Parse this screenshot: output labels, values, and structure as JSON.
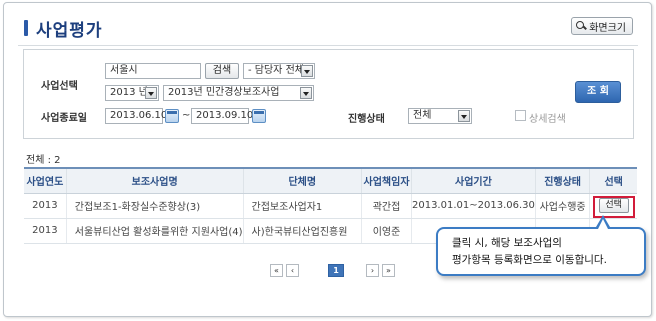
{
  "header": {
    "title": "사업평가",
    "zoom_button": "화면크기"
  },
  "search": {
    "business_select_label": "사업선택",
    "keyword_value": "서울시",
    "search_button": "검색",
    "manager_select": "- 담당자 전체 -",
    "year_select": "2013 년",
    "project_select": "2013년 민간경상보조사업",
    "end_date_label": "사업종료일",
    "date_from": "2013.06.10",
    "tilde": "~",
    "date_to": "2013.09.10",
    "status_label": "진행상태",
    "status_select": "전체",
    "detail_checkbox_label": "상세검색",
    "submit_button": "조 회"
  },
  "results": {
    "total_text": "전체 : 2",
    "columns": [
      "사업연도",
      "보조사업명",
      "단체명",
      "사업책임자",
      "사업기간",
      "진행상태",
      "선택"
    ],
    "rows": [
      {
        "year": "2013",
        "name": "간접보조1-화장실수준향상(3)",
        "org": "간접보조사업자1",
        "manager": "곽간접",
        "period": "2013.01.01~2013.06.30",
        "status": "사업수행중",
        "select": "선택"
      },
      {
        "year": "2013",
        "name": "서울뷰티산업 활성화를위한 지원사업(4)",
        "org": "사)한국뷰티산업진흥원",
        "manager": "이영준",
        "period": "",
        "status": "",
        "select": ""
      }
    ]
  },
  "pagination": {
    "first": "«",
    "prev": "‹",
    "current": "1",
    "next": "›",
    "last": "»"
  },
  "tooltip": {
    "line1": "클릭 시, 해당 보조사업의",
    "line2": "평가항목 등록화면으로 이동합니다."
  },
  "colors": {
    "accent": "#2e66b0",
    "title": "#1d3f7e",
    "highlight_border": "#d21c3a",
    "tooltip_border": "#3c7cc4"
  }
}
